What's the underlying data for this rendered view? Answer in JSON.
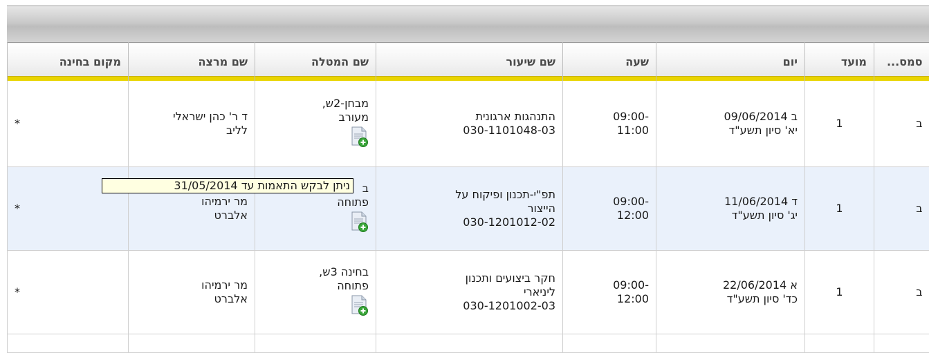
{
  "header": {
    "col_status": "סמס...",
    "col_moed": "מועד",
    "col_day": "יום",
    "col_time": "שעה",
    "col_lesson": "שם שיעור",
    "col_task": "שם המטלה",
    "col_lecturer": "שם מרצה",
    "col_location": "מקום בחינה"
  },
  "rows": [
    {
      "status": "ב",
      "moed": "1",
      "day_line1": "ב 09/06/2014",
      "day_line2": "יא' סיון תשע\"ד",
      "time_line1": "09:00-",
      "time_line2": "11:00",
      "lesson_line1": "התנהגות ארגונית",
      "lesson_line2": "",
      "lesson_code": "030-1101048-03",
      "task_line1": "מבחן-2ש,",
      "task_line2": "מעורב",
      "lecturer_line1": "ד ר' כהן ישראלי",
      "lecturer_line2": "לליב",
      "location": "*"
    },
    {
      "status": "ב",
      "moed": "1",
      "day_line1": "ד 11/06/2014",
      "day_line2": "יג' סיון תשע\"ד",
      "time_line1": "09:00-",
      "time_line2": "12:00",
      "lesson_line1": "תפ\"י-תכנון ופיקוח על",
      "lesson_line2": "הייצור",
      "lesson_code": "030-1201012-02",
      "task_line1": "ב",
      "task_line2": "פתוחה",
      "lecturer_line1": "מר ירמיהו",
      "lecturer_line2": "אלברט",
      "location": "*"
    },
    {
      "status": "ב",
      "moed": "1",
      "day_line1": "א 22/06/2014",
      "day_line2": "כד' סיון תשע\"ד",
      "time_line1": "09:00-",
      "time_line2": "12:00",
      "lesson_line1": "חקר ביצועים ותכנון",
      "lesson_line2": "ליניארי",
      "lesson_code": "030-1201002-03",
      "task_line1": "בחינה 3ש,",
      "task_line2": "פתוחה",
      "lecturer_line1": "מר ירמיהו",
      "lecturer_line2": "אלברט",
      "location": "*"
    }
  ],
  "tooltip": {
    "text": "ניתן לבקש התאמות עד  31/05/2014"
  },
  "icons": {
    "task_icon": "document-add-icon"
  },
  "colors": {
    "header_underline": "#e9d400",
    "selected_row": "#eaf1fb",
    "tooltip_bg": "#ffffe1"
  }
}
